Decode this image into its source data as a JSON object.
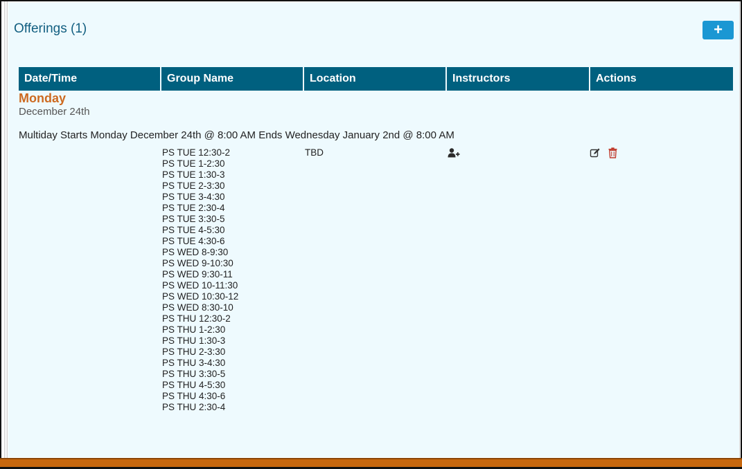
{
  "header": {
    "title": "Offerings (1)",
    "add_label": "+"
  },
  "table": {
    "columns": [
      "Date/Time",
      "Group Name",
      "Location",
      "Instructors",
      "Actions"
    ]
  },
  "offering": {
    "day": "Monday",
    "date": "December 24th",
    "multiday": "Multiday Starts Monday December 24th @ 8:00 AM Ends Wednesday January 2nd @ 8:00 AM",
    "location": "TBD",
    "groups": [
      "PS TUE 12:30-2",
      "PS TUE 1-2:30",
      "PS TUE 1:30-3",
      "PS TUE 2-3:30",
      "PS TUE 3-4:30",
      "PS TUE 2:30-4",
      "PS TUE 3:30-5",
      "PS TUE 4-5:30",
      "PS TUE 4:30-6",
      "PS WED 8-9:30",
      "PS WED 9-10:30",
      "PS WED 9:30-11",
      "PS WED 10-11:30",
      "PS WED 10:30-12",
      "PS WED 8:30-10",
      "PS THU 12:30-2",
      "PS THU 1-2:30",
      "PS THU 1:30-3",
      "PS THU 2-3:30",
      "PS THU 3-4:30",
      "PS THU 3:30-5",
      "PS THU 4-5:30",
      "PS THU 4:30-6",
      "PS THU 2:30-4"
    ],
    "icons": {
      "add_instructor": "user-plus-icon",
      "edit": "edit-icon",
      "delete": "trash-icon"
    }
  },
  "colors": {
    "panel_bg": "#eefafe",
    "title": "#115e80",
    "header_bg": "#00607f",
    "add_button": "#1b97d3",
    "day": "#cd6a20",
    "delete_icon": "#c0392b",
    "footer": "#c8680e"
  }
}
